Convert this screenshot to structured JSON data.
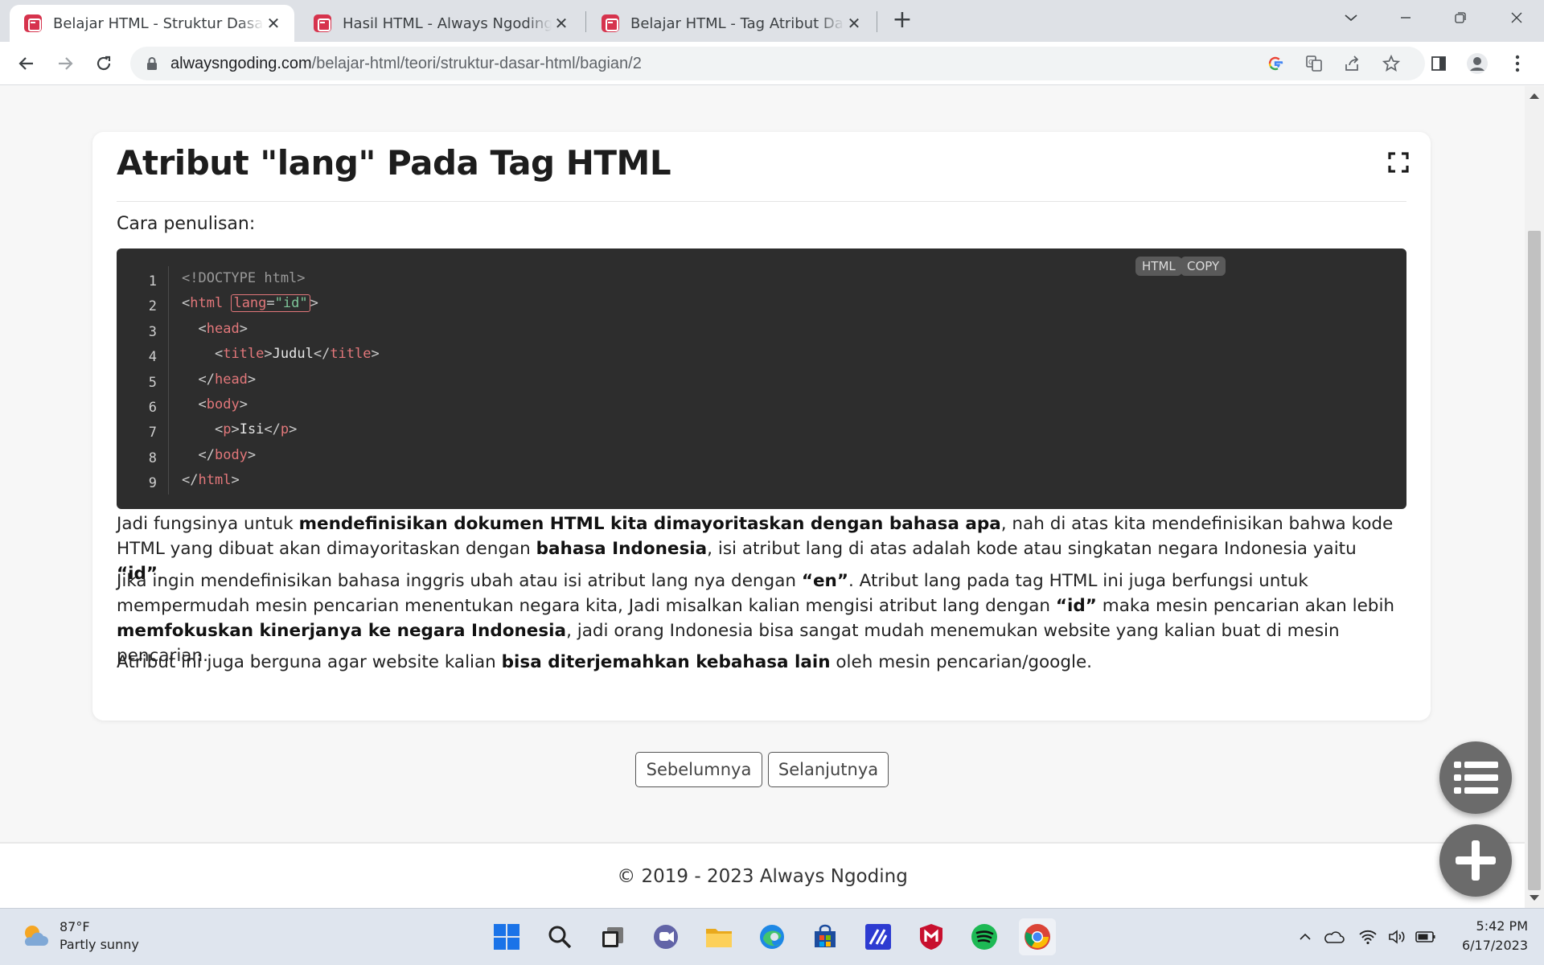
{
  "browser": {
    "tabs": [
      {
        "title": "Belajar HTML - Struktur Dasar HTML",
        "active": true
      },
      {
        "title": "Hasil HTML - Always Ngoding",
        "active": false
      },
      {
        "title": "Belajar HTML - Tag Atribut Dan Elemen",
        "active": false
      }
    ],
    "url_host": "alwaysngoding.com",
    "url_path": "/belajar-html/teori/struktur-dasar-html/bagian/2",
    "favicon_color": "#d6334d"
  },
  "page": {
    "heading": "Atribut \"lang\" Pada Tag HTML",
    "lead": "Cara penulisan:",
    "code_badges": {
      "lang": "HTML",
      "copy": "COPY"
    },
    "code_line_numbers": [
      "1",
      "2",
      "3",
      "4",
      "5",
      "6",
      "7",
      "8",
      "9"
    ],
    "code_lines": [
      "<!DOCTYPE html>",
      "<html lang=\"id\">",
      "  <head>",
      "    <title>Judul</title>",
      "  </head>",
      "  <body>",
      "    <p>Isi</p>",
      "  </body>",
      "</html>"
    ],
    "p1": {
      "t1": "Jadi fungsinya untuk ",
      "b1": "mendefinisikan dokumen HTML kita dimayoritaskan dengan bahasa apa",
      "t2": ", nah di atas kita mendefinisikan bahwa kode HTML yang dibuat akan dimayoritaskan dengan ",
      "b2": "bahasa Indonesia",
      "t3": ", isi atribut lang di atas adalah kode atau singkatan negara Indonesia yaitu ",
      "b3": "“id”",
      "t4": "."
    },
    "p2": {
      "t1": "Jika ingin mendefinisikan bahasa inggris ubah atau isi atribut lang nya dengan ",
      "b1": "“en”",
      "t2": ". Atribut lang pada tag HTML ini juga berfungsi untuk mempermudah mesin pencarian menentukan negara kita, Jadi misalkan kalian mengisi atribut lang dengan ",
      "b2": "“id”",
      "t3": " maka mesin pencarian akan lebih ",
      "b3": "memfokuskan kinerjanya ke negara Indonesia",
      "t4": ", jadi orang Indonesia bisa sangat mudah menemukan website yang kalian buat di mesin pencarian."
    },
    "p3": {
      "t1": "Atribut ini juga berguna agar website kalian ",
      "b1": "bisa diterjemahkan kebahasa lain",
      "t2": " oleh mesin pencarian/google."
    },
    "prev_label": "Sebelumnya",
    "next_label": "Selanjutnya",
    "footer": "© 2019 - 2023 Always Ngoding"
  },
  "taskbar": {
    "temp": "87°F",
    "condition": "Partly sunny",
    "time": "5:42 PM",
    "date": "6/17/2023"
  },
  "colors": {
    "code_bg": "#2d2d2d",
    "code_tag": "#e2777a",
    "code_string": "#7ec699",
    "fab_bg": "#6b6b6b"
  }
}
